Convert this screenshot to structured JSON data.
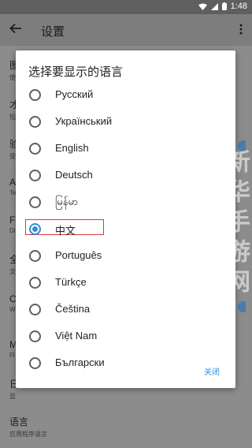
{
  "status_bar": {
    "time": "1:48",
    "icons": [
      "wifi-icon",
      "signal-icon",
      "battery-icon"
    ]
  },
  "app_bar": {
    "title": "设置"
  },
  "background_items": [
    {
      "title": "图",
      "subtitle": "使"
    },
    {
      "title": "才",
      "subtitle": "短"
    },
    {
      "title": "验",
      "subtitle": "受"
    },
    {
      "title": "A",
      "subtitle": "Te"
    },
    {
      "title": "Fl",
      "subtitle": "Di"
    },
    {
      "title": "全",
      "subtitle": "文"
    },
    {
      "title": "C",
      "subtitle": "W"
    },
    {
      "title": "M",
      "subtitle": "Fl"
    },
    {
      "title": "日",
      "subtitle": "显"
    },
    {
      "title": "语言",
      "subtitle": "应用程序语言"
    }
  ],
  "dialog": {
    "title": "选择要显示的语言",
    "options": [
      {
        "label": "Русский",
        "selected": false
      },
      {
        "label": "Український",
        "selected": false
      },
      {
        "label": "English",
        "selected": false
      },
      {
        "label": "Deutsch",
        "selected": false
      },
      {
        "label": "မြန်မာ",
        "selected": false
      },
      {
        "label": "中文",
        "selected": true
      },
      {
        "label": "Português",
        "selected": false
      },
      {
        "label": "Türkçe",
        "selected": false
      },
      {
        "label": "Čeština",
        "selected": false
      },
      {
        "label": "Việt Nam",
        "selected": false
      },
      {
        "label": "Български",
        "selected": false
      }
    ],
    "close_label": "关闭"
  },
  "colors": {
    "accent": "#2e8fd6",
    "highlight_box": "#d9373b"
  },
  "watermark": "新华手游网"
}
